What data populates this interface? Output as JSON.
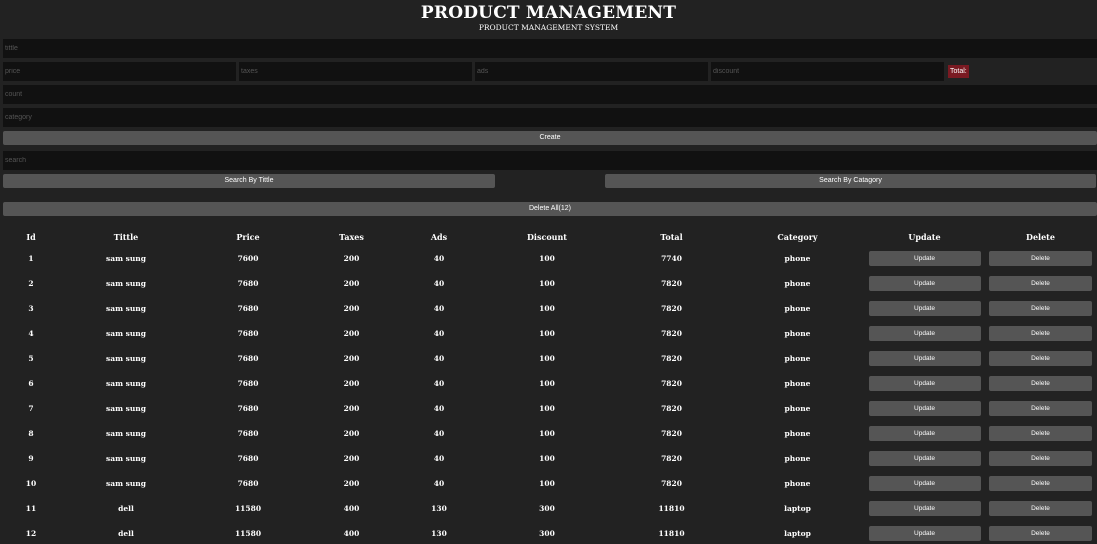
{
  "header": {
    "title": "PRODUCT MANAGEMENT",
    "subtitle": "PRODUCT MANAGEMENT SYSTEM"
  },
  "form": {
    "title_placeholder": "tittle",
    "price_placeholder": "price",
    "taxes_placeholder": "taxes",
    "ads_placeholder": "ads",
    "discount_placeholder": "discount",
    "total_label": "Total:",
    "count_placeholder": "count",
    "category_placeholder": "category",
    "create_label": "Create"
  },
  "search": {
    "placeholder": "search",
    "by_title_label": "Search By Tittle",
    "by_category_label": "Search By Catagory"
  },
  "delete_all_label": "Delete All(12)",
  "table": {
    "columns": [
      "Id",
      "Tittle",
      "Price",
      "Taxes",
      "Ads",
      "Discount",
      "Total",
      "Category",
      "Update",
      "Delete"
    ],
    "rows": [
      {
        "id": "1",
        "title": "sam sung",
        "price": "7600",
        "taxes": "200",
        "ads": "40",
        "discount": "100",
        "total": "7740",
        "category": "phone",
        "update": "Update",
        "delete": "Delete"
      },
      {
        "id": "2",
        "title": "sam sung",
        "price": "7680",
        "taxes": "200",
        "ads": "40",
        "discount": "100",
        "total": "7820",
        "category": "phone",
        "update": "Update",
        "delete": "Delete"
      },
      {
        "id": "3",
        "title": "sam sung",
        "price": "7680",
        "taxes": "200",
        "ads": "40",
        "discount": "100",
        "total": "7820",
        "category": "phone",
        "update": "Update",
        "delete": "Delete"
      },
      {
        "id": "4",
        "title": "sam sung",
        "price": "7680",
        "taxes": "200",
        "ads": "40",
        "discount": "100",
        "total": "7820",
        "category": "phone",
        "update": "Update",
        "delete": "Delete"
      },
      {
        "id": "5",
        "title": "sam sung",
        "price": "7680",
        "taxes": "200",
        "ads": "40",
        "discount": "100",
        "total": "7820",
        "category": "phone",
        "update": "Update",
        "delete": "Delete"
      },
      {
        "id": "6",
        "title": "sam sung",
        "price": "7680",
        "taxes": "200",
        "ads": "40",
        "discount": "100",
        "total": "7820",
        "category": "phone",
        "update": "Update",
        "delete": "Delete"
      },
      {
        "id": "7",
        "title": "sam sung",
        "price": "7680",
        "taxes": "200",
        "ads": "40",
        "discount": "100",
        "total": "7820",
        "category": "phone",
        "update": "Update",
        "delete": "Delete"
      },
      {
        "id": "8",
        "title": "sam sung",
        "price": "7680",
        "taxes": "200",
        "ads": "40",
        "discount": "100",
        "total": "7820",
        "category": "phone",
        "update": "Update",
        "delete": "Delete"
      },
      {
        "id": "9",
        "title": "sam sung",
        "price": "7680",
        "taxes": "200",
        "ads": "40",
        "discount": "100",
        "total": "7820",
        "category": "phone",
        "update": "Update",
        "delete": "Delete"
      },
      {
        "id": "10",
        "title": "sam sung",
        "price": "7680",
        "taxes": "200",
        "ads": "40",
        "discount": "100",
        "total": "7820",
        "category": "phone",
        "update": "Update",
        "delete": "Delete"
      },
      {
        "id": "11",
        "title": "dell",
        "price": "11580",
        "taxes": "400",
        "ads": "130",
        "discount": "300",
        "total": "11810",
        "category": "laptop",
        "update": "Update",
        "delete": "Delete"
      },
      {
        "id": "12",
        "title": "dell",
        "price": "11580",
        "taxes": "400",
        "ads": "130",
        "discount": "300",
        "total": "11810",
        "category": "laptop",
        "update": "Update",
        "delete": "Delete"
      }
    ]
  }
}
